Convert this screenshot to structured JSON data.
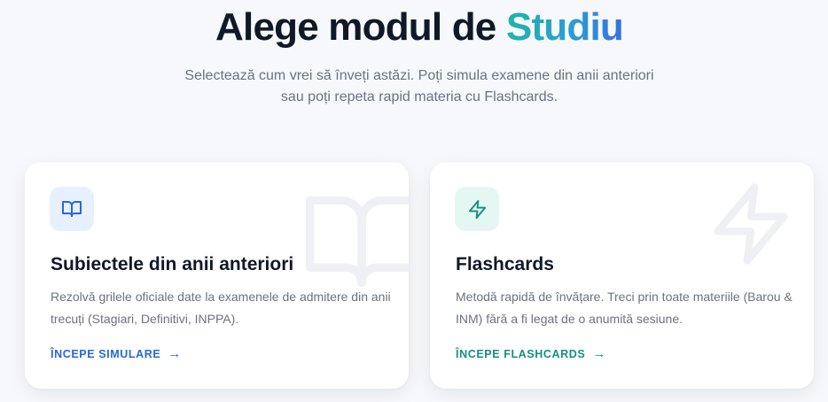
{
  "header": {
    "title_prefix": "Alege modul de",
    "title_accent": "Studiu",
    "subtitle_line1": "Selectează cum vrei să înveți astăzi. Poți simula examene din anii anteriori",
    "subtitle_line2": "sau poți repeta rapid materia cu Flashcards."
  },
  "cards": [
    {
      "icon": "book-open-icon",
      "title": "Subiectele din anii anteriori",
      "description": "Rezolvă grilele oficiale date la examenele de admitere din anii trecuți (Stagiari, Definitivi, INPPA).",
      "cta": "ÎNCEPE SIMULARE",
      "arrow": "→",
      "accent_color": "#2a67d6"
    },
    {
      "icon": "lightning-icon",
      "title": "Flashcards",
      "description": "Metodă rapidă de învățare. Treci prin toate materiile (Barou & INM) fără a fi legat de o anumită sesiune.",
      "cta": "ÎNCEPE FLASHCARDS",
      "arrow": "→",
      "accent_color": "#14907e"
    }
  ]
}
